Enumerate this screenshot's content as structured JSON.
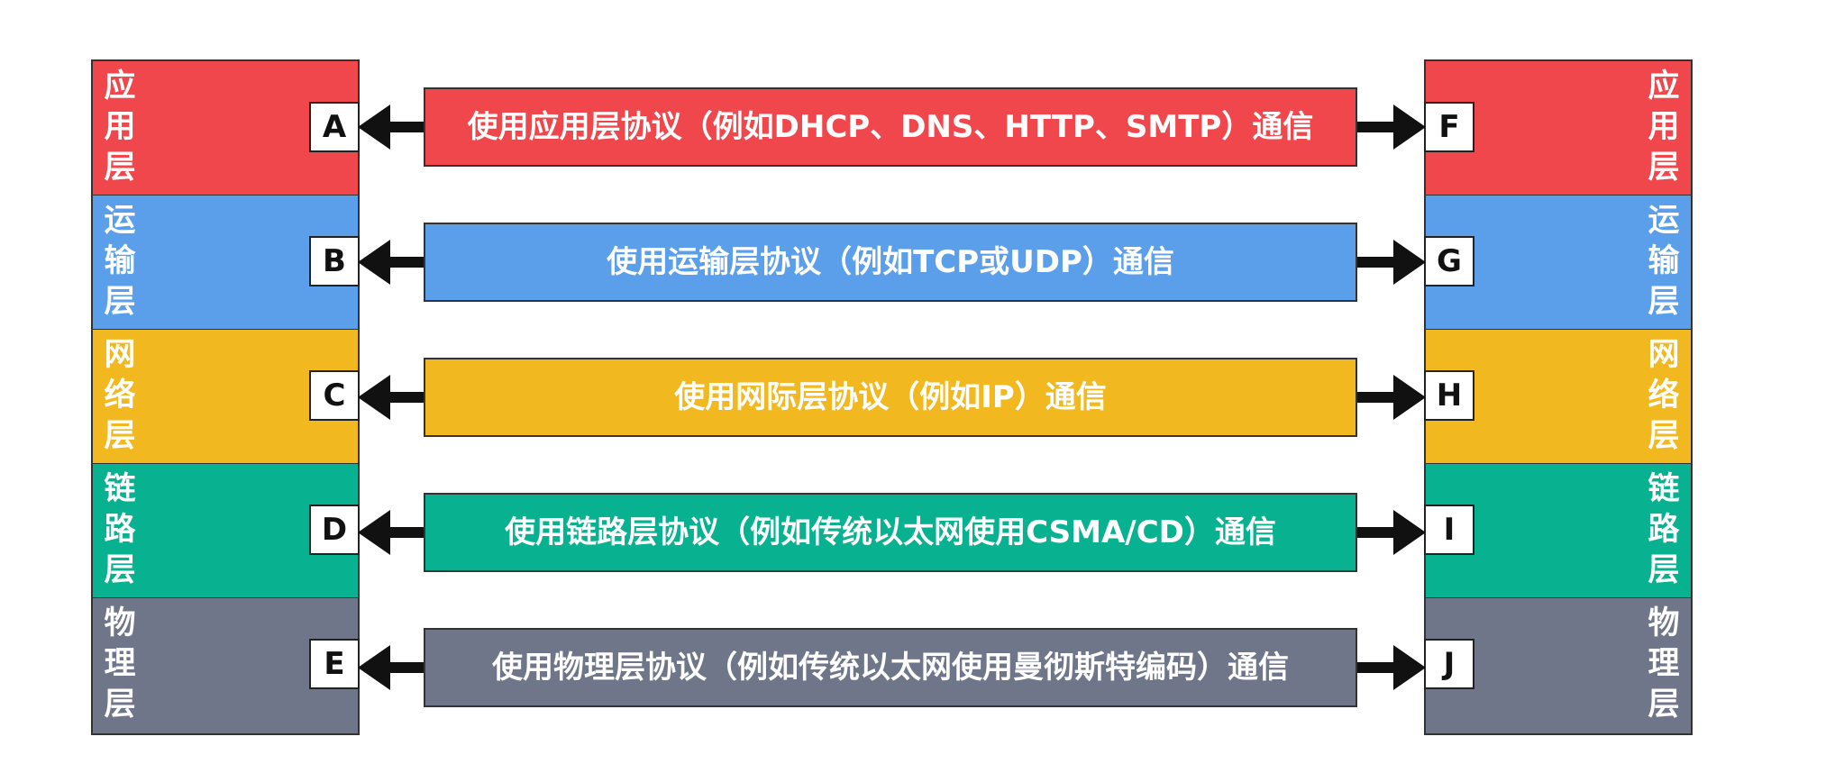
{
  "colors": {
    "application": "#f0474d",
    "transport": "#5b9fea",
    "network": "#f2b81f",
    "link": "#08b291",
    "physical": "#6f7689"
  },
  "left_stack": {
    "layers": [
      {
        "name": "应用层",
        "letter": "A"
      },
      {
        "name": "运输层",
        "letter": "B"
      },
      {
        "name": "网络层",
        "letter": "C"
      },
      {
        "name": "链路层",
        "letter": "D"
      },
      {
        "name": "物理层",
        "letter": "E"
      }
    ]
  },
  "right_stack": {
    "layers": [
      {
        "name": "应用层",
        "letter": "F"
      },
      {
        "name": "运输层",
        "letter": "G"
      },
      {
        "name": "网络层",
        "letter": "H"
      },
      {
        "name": "链路层",
        "letter": "I"
      },
      {
        "name": "物理层",
        "letter": "J"
      }
    ]
  },
  "connections": [
    {
      "label": "使用应用层协议（例如DHCP、DNS、HTTP、SMTP）通信"
    },
    {
      "label": "使用运输层协议（例如TCP或UDP）通信"
    },
    {
      "label": "使用网际层协议（例如IP）通信"
    },
    {
      "label": "使用链路层协议（例如传统以太网使用CSMA/CD）通信"
    },
    {
      "label": "使用物理层协议（例如传统以太网使用曼彻斯特编码）通信"
    }
  ]
}
